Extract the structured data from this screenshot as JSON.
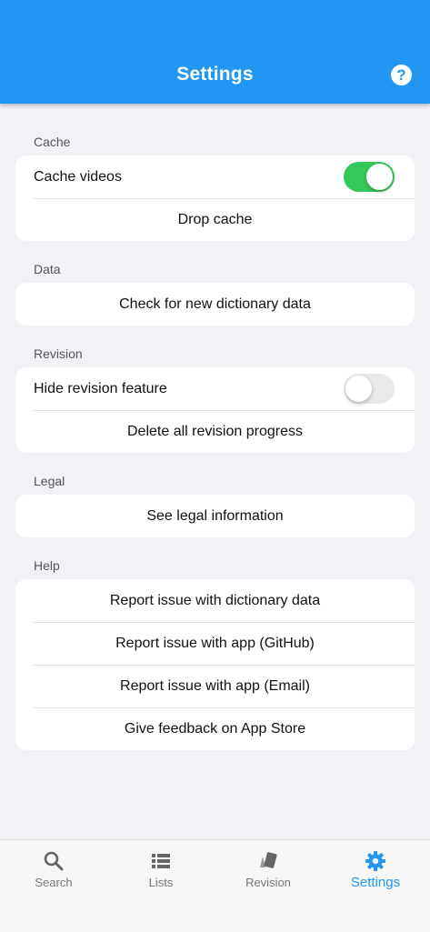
{
  "header": {
    "title": "Settings",
    "help_icon": "help-circle-icon"
  },
  "sections": {
    "cache": {
      "label": "Cache",
      "cache_videos_label": "Cache videos",
      "cache_videos_enabled": true,
      "drop_cache_label": "Drop cache"
    },
    "data": {
      "label": "Data",
      "check_label": "Check for new dictionary data"
    },
    "revision": {
      "label": "Revision",
      "hide_label": "Hide revision feature",
      "hide_enabled": false,
      "delete_label": "Delete all revision progress"
    },
    "legal": {
      "label": "Legal",
      "see_label": "See legal information"
    },
    "help": {
      "label": "Help",
      "items": [
        "Report issue with dictionary data",
        "Report issue with app (GitHub)",
        "Report issue with app (Email)",
        "Give feedback on App Store"
      ]
    }
  },
  "nav": {
    "items": [
      {
        "label": "Search",
        "icon": "search-icon"
      },
      {
        "label": "Lists",
        "icon": "list-icon"
      },
      {
        "label": "Revision",
        "icon": "cards-icon"
      },
      {
        "label": "Settings",
        "icon": "gear-icon",
        "active": true
      }
    ]
  },
  "colors": {
    "primary": "#2196f3",
    "switch_on": "#34c759",
    "background": "#f2f1f6"
  }
}
